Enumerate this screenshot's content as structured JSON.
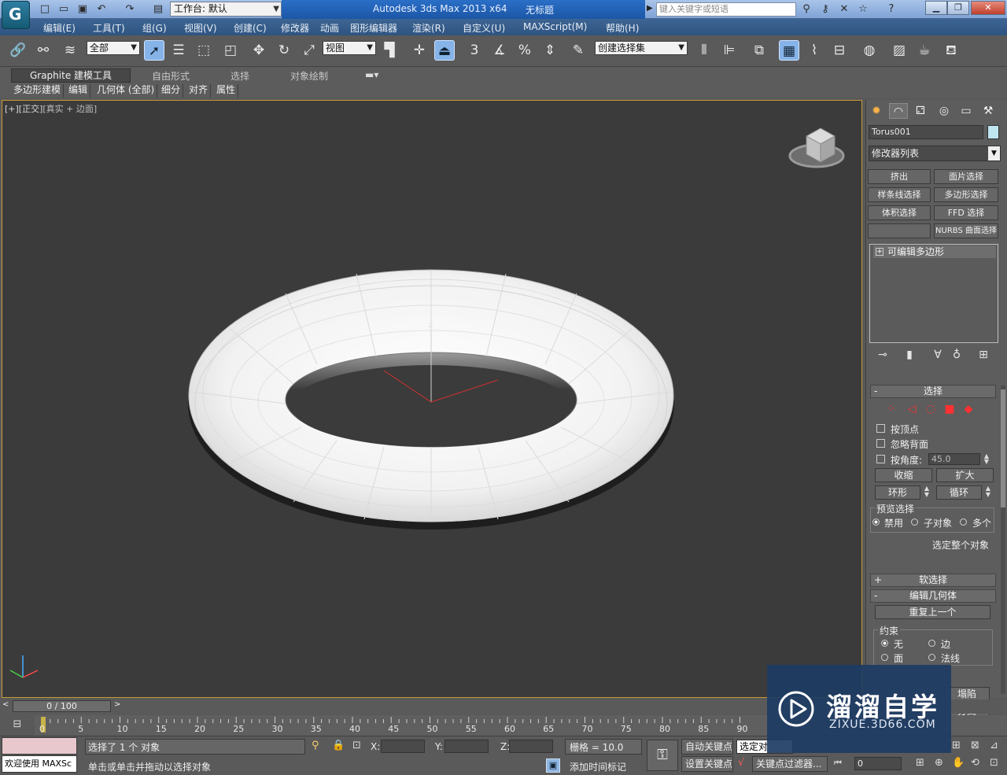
{
  "window": {
    "app_title": "Autodesk 3ds Max  2013 x64",
    "doc_title": "无标题",
    "workspace": "工作台: 默认",
    "search_placeholder": "键入关键字或短语"
  },
  "menu": [
    "编辑(E)",
    "工具(T)",
    "组(G)",
    "视图(V)",
    "创建(C)",
    "修改器",
    "动画",
    "图形编辑器",
    "渲染(R)",
    "自定义(U)",
    "MAXScript(M)",
    "帮助(H)"
  ],
  "toolbar": {
    "selection_filter": "全部",
    "ref_coord": "视图",
    "named_selection": "创建选择集",
    "snap_3": "3",
    "snap_percent": "%"
  },
  "ribbon": {
    "tabs": [
      "Graphite 建模工具",
      "自由形式",
      "选择",
      "对象绘制"
    ],
    "sub_tabs": [
      "多边形建模",
      "编辑",
      "几何体 (全部)",
      "细分",
      "对齐",
      "属性"
    ]
  },
  "viewport": {
    "label_main": "[+][正交]",
    "label_dim": "[真实 + 边面]",
    "gizmo_axis": "z"
  },
  "command_panel": {
    "object_name": "Torus001",
    "object_color": "#bfe6f0",
    "modifier_list": "修改器列表",
    "modifier_buttons": [
      "挤出",
      "面片选择",
      "样条线选择",
      "多边形选择",
      "体积选择",
      "FFD 选择",
      "",
      "NURBS 曲面选择"
    ],
    "stack_item": "可编辑多边形",
    "stack_plus": "+",
    "selection_rollout": {
      "title": "选择",
      "sign": "-",
      "by_vertex": "按顶点",
      "ignore_backfacing": "忽略背面",
      "by_angle": "按角度:",
      "angle_value": "45.0",
      "shrink": "收缩",
      "grow": "扩大",
      "ring": "环形",
      "loop": "循环",
      "preview_group": "预览选择",
      "preview_disabled": "禁用",
      "preview_subobject": "子对象",
      "preview_multi": "多个",
      "whole_object": "选定整个对象"
    },
    "soft_selection": {
      "title": "软选择",
      "sign": "+"
    },
    "edit_geometry": {
      "title": "编辑几何体",
      "sign": "-",
      "repeat_last": "重复上一个",
      "constraint_group": "约束",
      "none": "无",
      "edge": "边",
      "face": "面",
      "normal": "法线",
      "collapse": "塌陷",
      "detach": "分离"
    }
  },
  "timeline": {
    "position": "0 / 100",
    "ticks": [
      "0",
      "5",
      "10",
      "15",
      "20",
      "25",
      "30",
      "35",
      "40",
      "45",
      "50",
      "55",
      "60",
      "65",
      "70",
      "75",
      "80",
      "85",
      "90"
    ]
  },
  "status": {
    "maxscript_text": "欢迎使用 MAXSc",
    "selection_status": "选择了 1 个 对象",
    "prompt": "单击或单击并拖动以选择对象",
    "x_label": "X:",
    "y_label": "Y:",
    "z_label": "Z:",
    "grid": "栅格 = 10.0",
    "add_time_tag": "添加时间标记",
    "auto_key": "自动关键点",
    "selected": "选定对",
    "set_key": "设置关键点",
    "key_filters": "关键点过滤器...",
    "frame": "0"
  },
  "watermark": {
    "text": "溜溜自学",
    "url": "ZIXUE.3D66.COM"
  }
}
